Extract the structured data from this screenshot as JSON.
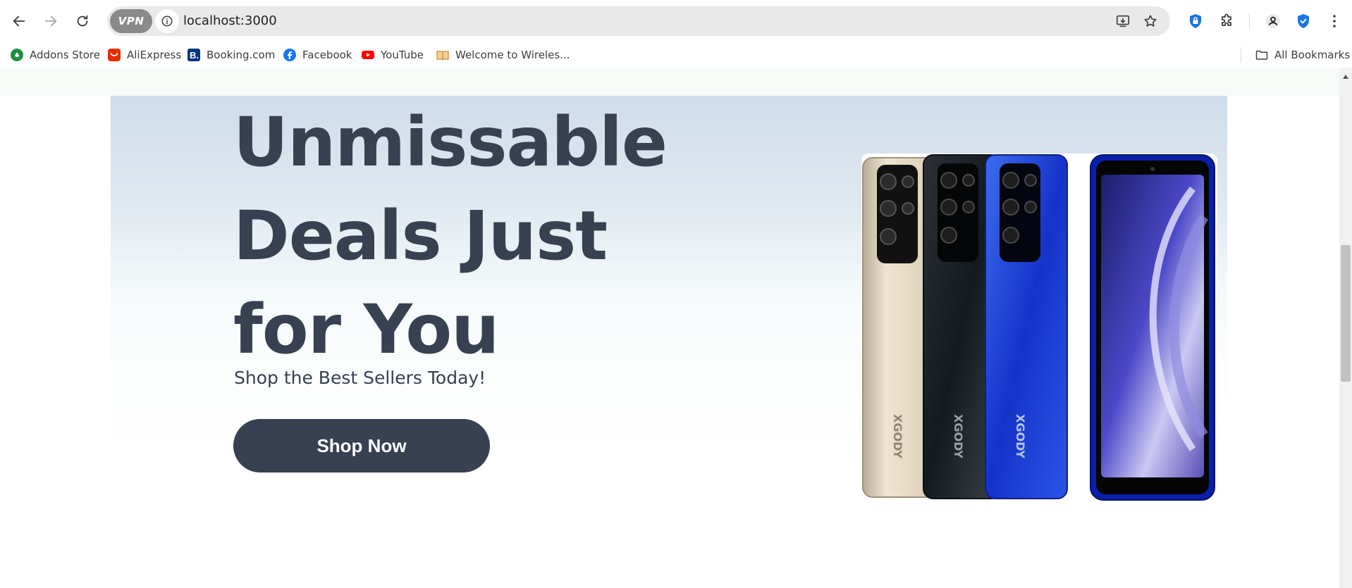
{
  "browser": {
    "url": "localhost:3000",
    "vpn_label": "VPN",
    "nav": {
      "back_icon": "arrow-left-icon",
      "forward_icon": "arrow-right-icon",
      "reload_icon": "reload-icon"
    },
    "bookmarks": [
      {
        "label": "Addons Store",
        "icon": "addons-store-icon",
        "color": "#1e8e3e"
      },
      {
        "label": "AliExpress",
        "icon": "aliexpress-icon",
        "color": "#e62e04"
      },
      {
        "label": "Booking.com",
        "icon": "booking-icon",
        "color": "#003580"
      },
      {
        "label": "Facebook",
        "icon": "facebook-icon",
        "color": "#1877f2"
      },
      {
        "label": "YouTube",
        "icon": "youtube-icon",
        "color": "#ff0000"
      },
      {
        "label": "Welcome to Wireles...",
        "icon": "book-icon",
        "color": "#e0a040"
      }
    ],
    "all_bookmarks": "All Bookmarks"
  },
  "hero": {
    "title": "Unmissable Deals Just for You",
    "subtitle": "Shop the Best Sellers Today!",
    "button_label": "Shop Now",
    "phone_brand": "XGODY"
  },
  "colors": {
    "heading": "#374151",
    "button": "#374151",
    "hero_top": "#cfdceb"
  }
}
